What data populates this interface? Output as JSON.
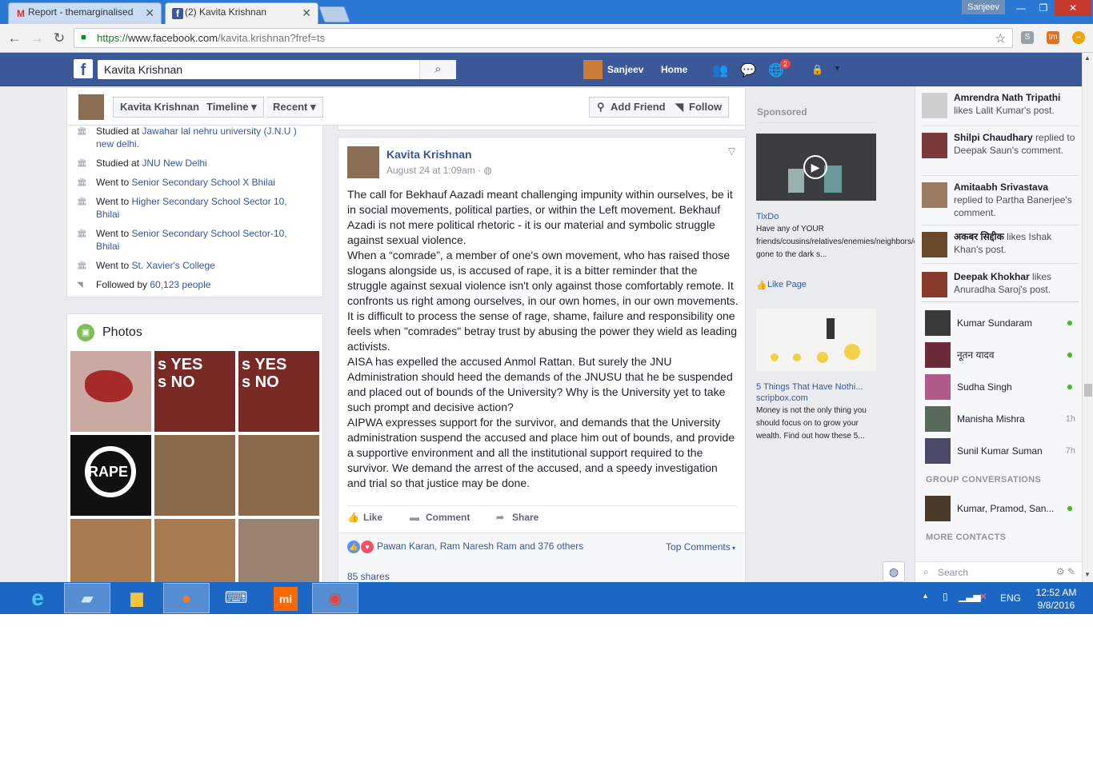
{
  "browser": {
    "tabs": [
      {
        "label": "Report - themarginalised",
        "icon": "gmail-icon",
        "active": false
      },
      {
        "label": "(2) Kavita Krishnan",
        "icon": "facebook-icon",
        "active": true
      }
    ],
    "window_user": "Sanjeev",
    "url_scheme": "https://",
    "url_host": "www.facebook.com",
    "url_path": "/kavita.krishnan?fref=ts"
  },
  "facebook": {
    "search_value": "Kavita Krishnan",
    "user_name": "Sanjeev",
    "home_label": "Home",
    "notification_count": "2"
  },
  "profile_nav": {
    "name": "Kavita Krishnan",
    "timeline": "Timeline",
    "recent": "Recent",
    "add_friend": "Add Friend",
    "follow": "Follow"
  },
  "intro": [
    {
      "prefix": "Studied at ",
      "link": "Jawahar lal nehru university (J.N.U ) new delhi.",
      "icon": "school-icon"
    },
    {
      "prefix": "Studied at ",
      "link": "JNU New Delhi",
      "icon": "school-icon"
    },
    {
      "prefix": "Went to ",
      "link": "Senior Secondary School X Bhilai",
      "icon": "school-icon"
    },
    {
      "prefix": "Went to ",
      "link": "Higher Secondary School Sector 10, Bhilai",
      "icon": "school-icon"
    },
    {
      "prefix": "Went to ",
      "link": "Senior Secondary School Sector-10, Bhilai",
      "icon": "school-icon"
    },
    {
      "prefix": "Went to ",
      "link": "St. Xavier's College",
      "icon": "school-icon"
    },
    {
      "prefix": "Followed by ",
      "link": "60,123 people",
      "icon": "rss-icon"
    }
  ],
  "photos": {
    "title": "Photos",
    "items": [
      {
        "label": "",
        "color": "#c9a9a2"
      },
      {
        "label": "s YES\ns NO",
        "color": "#7a2a24"
      },
      {
        "label": "s YES\ns NO",
        "color": "#7a2a24"
      },
      {
        "label": "RAPE",
        "color": "#111111"
      },
      {
        "label": "",
        "color": "#8a6a4a"
      },
      {
        "label": "",
        "color": "#8a6a4a"
      },
      {
        "label": "",
        "color": "#a87a50"
      },
      {
        "label": "",
        "color": "#a87a50"
      },
      {
        "label": "",
        "color": "#9a8270"
      }
    ]
  },
  "post": {
    "author": "Kavita Krishnan",
    "timestamp": "August 24 at 1:09am · ",
    "paragraphs": [
      "The call for Bekhauf Aazadi meant challenging impunity within ourselves, be it in social movements, political parties, or within the Left movement. Bekhauf Azadi is not mere political rhetoric - it is our material and symbolic struggle against sexual violence.",
      "When a “comrade”, a member of one's own movement, who has raised those slogans alongside us, is accused of rape, it is a bitter reminder that the struggle against sexual violence isn't only against those comfortably remote. It confronts us right among ourselves, in our own homes, in our own movements. It is difficult to process the sense of rage, shame, failure and responsibility one feels when \"comrades\" betray trust by abusing the power they wield as leading activists.",
      "AISA has expelled the accused Anmol Rattan. But surely the JNU Administration should heed the demands of the JNUSU that he be suspended and placed out of bounds of the University? Why is the University yet to take such prompt and decisive action?",
      "AIPWA expresses support for the survivor, and demands that the University administration suspend the accused and place him out of bounds, and provide a supportive environment and all the institutional support required to the survivor. We demand the arrest of the accused, and a speedy investigation and trial so that justice may be done."
    ],
    "like": "Like",
    "comment": "Comment",
    "share": "Share",
    "reactors": "Pawan Karan, Ram Naresh Ram and 376 others",
    "top_comments": "Top Comments",
    "shares": "85 shares"
  },
  "sponsored": {
    "heading": "Sponsored",
    "ads": [
      {
        "title": "TixDo",
        "text": "Have any of YOUR friends/cousins/relatives/enemies/neighbors/colleagues gone to the dark s...",
        "action": "Like Page"
      },
      {
        "title": "5 Things That Have Nothi...",
        "domain": "scripbox.com",
        "text": "Money is not the only thing you should focus on to grow your wealth. Find out how these 5..."
      }
    ]
  },
  "ticker": [
    {
      "name": "Amrendra Nath Tripathi",
      "text": " likes Lalit Kumar's post.",
      "color": "#cfcfcf"
    },
    {
      "name": "Shilpi Chaudhary",
      "text": " replied to Deepak Saun's comment.",
      "color": "#7a3a3a"
    },
    {
      "name": "Amitaabh Srivastava",
      "text": " replied to Partha Banerjee's comment.",
      "color": "#9a7a60"
    },
    {
      "name": "अकबर सिद्दीक",
      "text": " likes Ishak Khan's post.",
      "color": "#6a4a2a"
    },
    {
      "name": "Deepak Khokhar",
      "text": " likes Anuradha Saroj's post.",
      "color": "#8a3a2a"
    }
  ],
  "contacts": [
    {
      "name": "Kumar Sundaram",
      "status": "online",
      "time": "",
      "color": "#3a3a3a"
    },
    {
      "name": "नूतन यादव",
      "status": "online",
      "time": "",
      "color": "#6a2a3a"
    },
    {
      "name": "Sudha Singh",
      "status": "online",
      "time": "",
      "color": "#b05a8a"
    },
    {
      "name": "Manisha Mishra",
      "status": "idle",
      "time": "1h",
      "color": "#5a6a5a"
    },
    {
      "name": "Sunil Kumar Suman",
      "status": "idle",
      "time": "7h",
      "color": "#4a4a6a"
    }
  ],
  "group_heading": "GROUP CONVERSATIONS",
  "group": {
    "name": "Kumar, Pramod, San...",
    "status": "online"
  },
  "more_contacts_heading": "MORE CONTACTS",
  "chat_search_placeholder": "Search",
  "taskbar": {
    "language": "ENG",
    "time": "12:52 AM",
    "date": "9/8/2016"
  }
}
